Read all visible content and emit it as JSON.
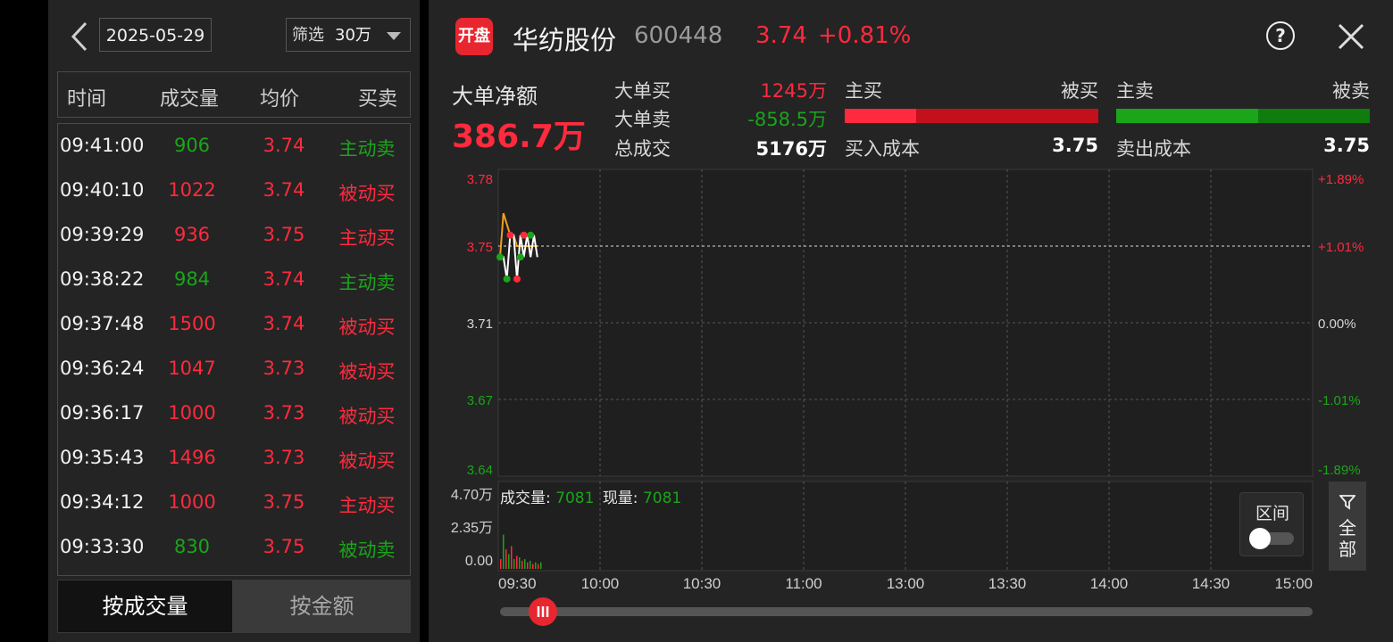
{
  "left_panel": {
    "date": "2025-05-29",
    "filter_label": "筛选",
    "filter_value": "30万",
    "headers": [
      "时间",
      "成交量",
      "均价",
      "买卖"
    ],
    "rows": [
      {
        "time": "09:41:00",
        "volume": "906",
        "price": "3.74",
        "type": "主动卖",
        "vol_color": "green",
        "price_color": "red",
        "type_color": "green"
      },
      {
        "time": "09:40:10",
        "volume": "1022",
        "price": "3.74",
        "type": "被动买",
        "vol_color": "red",
        "price_color": "red",
        "type_color": "red"
      },
      {
        "time": "09:39:29",
        "volume": "936",
        "price": "3.75",
        "type": "主动买",
        "vol_color": "red",
        "price_color": "red",
        "type_color": "red"
      },
      {
        "time": "09:38:22",
        "volume": "984",
        "price": "3.74",
        "type": "主动卖",
        "vol_color": "green",
        "price_color": "red",
        "type_color": "green"
      },
      {
        "time": "09:37:48",
        "volume": "1500",
        "price": "3.74",
        "type": "被动买",
        "vol_color": "red",
        "price_color": "red",
        "type_color": "red"
      },
      {
        "time": "09:36:24",
        "volume": "1047",
        "price": "3.73",
        "type": "被动买",
        "vol_color": "red",
        "price_color": "red",
        "type_color": "red"
      },
      {
        "time": "09:36:17",
        "volume": "1000",
        "price": "3.73",
        "type": "被动买",
        "vol_color": "red",
        "price_color": "red",
        "type_color": "red"
      },
      {
        "time": "09:35:43",
        "volume": "1496",
        "price": "3.73",
        "type": "被动买",
        "vol_color": "red",
        "price_color": "red",
        "type_color": "red"
      },
      {
        "time": "09:34:12",
        "volume": "1000",
        "price": "3.75",
        "type": "主动买",
        "vol_color": "red",
        "price_color": "red",
        "type_color": "red"
      },
      {
        "time": "09:33:30",
        "volume": "830",
        "price": "3.75",
        "type": "被动卖",
        "vol_color": "green",
        "price_color": "red",
        "type_color": "green"
      }
    ],
    "btn_by_volume": "按成交量",
    "btn_by_amount": "按金额"
  },
  "header": {
    "logo_text": "开盘",
    "name": "华纺股份",
    "code": "600448",
    "price": "3.74",
    "change": "+0.81%",
    "help_icon": "?"
  },
  "summary": {
    "net_label": "大单净额",
    "net_value": "386.7万",
    "big_buy_label": "大单买",
    "big_buy_value": "1245万",
    "big_sell_label": "大单卖",
    "big_sell_value": "-858.5万",
    "total_label": "总成交",
    "total_value": "5176万",
    "active_buy_label": "主买",
    "passive_buy_label": "被买",
    "active_sell_label": "主卖",
    "passive_sell_label": "被卖",
    "buy_bar_active_ratio": 0.28,
    "sell_bar_active_ratio": 0.56,
    "buy_cost_label": "买入成本",
    "buy_cost_value": "3.75",
    "sell_cost_label": "卖出成本",
    "sell_cost_value": "3.75",
    "colors": {
      "up": "#ff2a3d",
      "down": "#1aa51a",
      "up_dark": "#c4101c",
      "down_dark": "#0e7d0e"
    }
  },
  "chart_data": {
    "type": "line",
    "price_axis_left": [
      "3.78",
      "3.75",
      "3.71",
      "3.67",
      "3.64"
    ],
    "price_axis_right": [
      "+1.89%",
      "+1.01%",
      "0.00%",
      "-1.01%",
      "-1.89%"
    ],
    "price_range": [
      3.64,
      3.78
    ],
    "prev_close": 3.71,
    "time_labels": [
      "09:30",
      "10:00",
      "10:30",
      "11:00",
      "13:00",
      "13:30",
      "14:00",
      "14:30",
      "15:00"
    ],
    "price_series_minutes": [
      0,
      1,
      2,
      3,
      4,
      5,
      6,
      7,
      8,
      9,
      10,
      11
    ],
    "price_series": [
      3.74,
      3.74,
      3.73,
      3.75,
      3.75,
      3.73,
      3.75,
      3.74,
      3.75,
      3.74,
      3.75,
      3.74
    ],
    "avg_series": [
      3.74,
      3.76,
      3.755,
      3.75,
      3.75,
      3.745,
      3.745,
      3.745,
      3.745,
      3.745,
      3.745,
      3.745
    ],
    "markers": [
      {
        "minute": 0,
        "price": 3.74,
        "color": "green"
      },
      {
        "minute": 2,
        "price": 3.73,
        "color": "green"
      },
      {
        "minute": 3,
        "price": 3.75,
        "color": "red"
      },
      {
        "minute": 5,
        "price": 3.73,
        "color": "red"
      },
      {
        "minute": 6,
        "price": 3.74,
        "color": "green"
      },
      {
        "minute": 7,
        "price": 3.75,
        "color": "red"
      },
      {
        "minute": 9,
        "price": 3.75,
        "color": "green"
      }
    ],
    "volume_axis": [
      "4.70万",
      "2.35万",
      "0.00"
    ],
    "volume_max": 47000,
    "volumes": [
      6000,
      21000,
      12000,
      9000,
      14000,
      6000,
      8000,
      7000,
      5000,
      6000,
      4000,
      5000,
      3000,
      4000,
      3000,
      4000
    ],
    "volume_label": "成交量:",
    "volume_value": "7081",
    "current_label": "现量:",
    "current_value": "7081"
  },
  "controls": {
    "range_label": "区间",
    "all_label_1": "全",
    "all_label_2": "部"
  }
}
